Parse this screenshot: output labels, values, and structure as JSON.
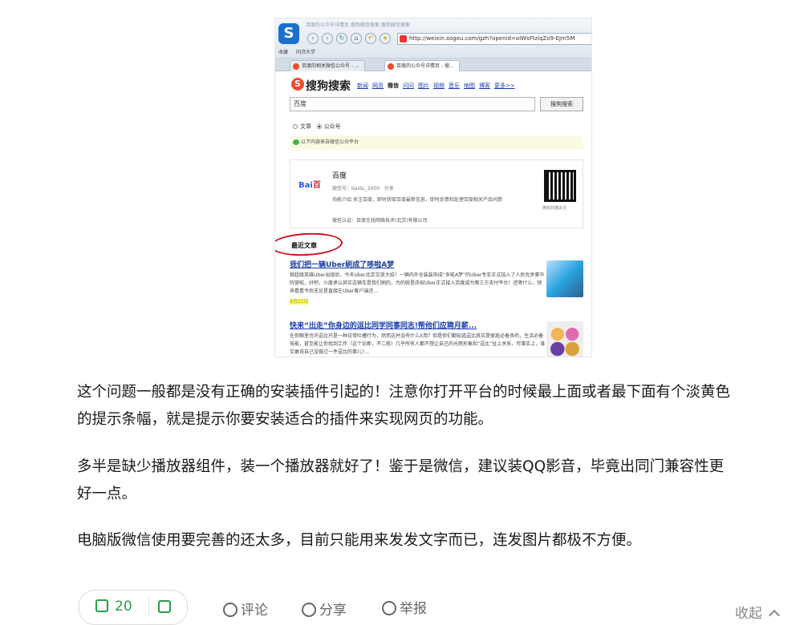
{
  "screenshot": {
    "browser": {
      "quick_menu": "百度的公众号详情页  搜狗微信搜索  搜狗微信搜索",
      "address": "http://weixin.sogou.com/gzh?openid=oIWsFtziqZo9-EJm5M",
      "bookmarks": [
        "收藏",
        "同济大学"
      ],
      "tabs": [
        "百度的相关微信公众号 - ...",
        "百度的公众号详情页 - 搜..."
      ]
    },
    "sogou": {
      "logo": "搜狗搜索",
      "nav": [
        "新闻",
        "网页",
        "微信",
        "问问",
        "图片",
        "视频",
        "音乐",
        "地图",
        "博客",
        "更多>>"
      ],
      "active_nav": "微信",
      "query": "百度",
      "search_button": "搜狗搜索",
      "radio_article": "文章",
      "radio_account": "公众号",
      "notice": "以下内容来自微信公众平台"
    },
    "account": {
      "logo": "Bai百",
      "name": "百度",
      "wechat_id": "微信号：baidu_2000",
      "share": "分享",
      "intro": "功能介绍  关注百度，即时获取百度最新信息，即时反馈和处理百度相关产品问题",
      "auth": "微信认证：百度在线网络技术(北京)有限公司",
      "qr_caption": "微信扫描关注"
    },
    "recent_label": "最近文章",
    "articles": [
      {
        "title": "我们把一辆Uber刷成了哆啦A梦",
        "body": "继超级英雄Uber出现后，今天Uber北京又放大招！一辆内外全装装饰成“多啦A梦”的Uber专车正式加入了人民优步豪华阵营啦，好吧，小度承认其实这辆车是我们刷的，为的就是庆祝Uber正式接入百度成为第三方支付平台！还等什么，快来看看今后无论是直接在Uber客户端还...",
        "date": "8月22日"
      },
      {
        "title": "快来“出走”你身边的逗比同学同事同志!帮他们应聘月薪...",
        "body": "在你眼里也许逗比只是一种日常吐槽行为，然而这并没有什么X用？但是你们都知道逗比其实是家庭必备良药，生活必备技能，甚至能让你找到工作（这个论断，不二般）几乎所有人都不想让自己的光辉形象和“逗比”扯上关系，可事实上，谁又敢说自己没做过一件逗比的事儿?..."
      }
    ]
  },
  "answer": {
    "paragraphs": [
      "这个问题一般都是没有正确的安装插件引起的！注意你打开平台的时候最上面或者最下面有个淡黄色",
      "的提示条幅，就是提示你要安装适合的插件来实现网页的功能。",
      "多半是缺少播放器组件，装一个播放器就好了！鉴于是微信，建议装QQ影音，毕竟出同门兼容性更",
      "好一点。",
      "电脑版微信使用要完善的还太多，目前只能用来发发文字而已，连发图片都极不方便。"
    ]
  },
  "actions": {
    "like_count": "20",
    "comment": "评论",
    "share": "分享",
    "report": "举报",
    "collapse": "收起"
  },
  "colors": {
    "accent_green": "#2a9d4a",
    "link_blue": "#1a3da8",
    "highlight_yellow": "#ffff3a",
    "annotation_red": "#d3101c"
  }
}
